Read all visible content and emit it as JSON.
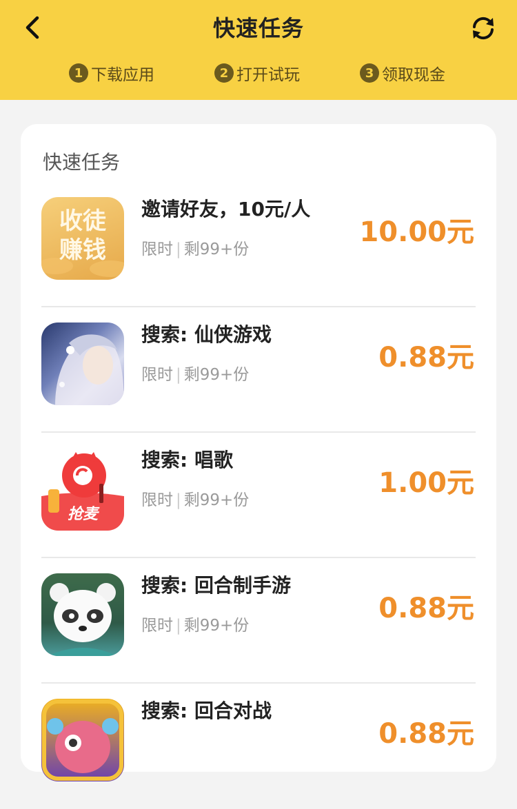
{
  "header": {
    "title": "快速任务",
    "steps": [
      {
        "num": "1",
        "label": "下载应用"
      },
      {
        "num": "2",
        "label": "打开试玩"
      },
      {
        "num": "3",
        "label": "领取现金"
      }
    ]
  },
  "section": {
    "title": "快速任务"
  },
  "tasks": [
    {
      "icon": "invite-friends-app-icon",
      "icon_text_1": "收徒",
      "icon_text_2": "赚钱",
      "name": "邀请好友，10元/人",
      "tag": "限时",
      "remaining": "剩99+份",
      "reward": "10.00元"
    },
    {
      "icon": "xianxia-game-app-icon",
      "name": "搜索: 仙侠游戏",
      "tag": "限时",
      "remaining": "剩99+份",
      "reward": "0.88元"
    },
    {
      "icon": "qiangmai-karaoke-app-icon",
      "icon_label": "抢麦",
      "name": "搜索: 唱歌",
      "tag": "限时",
      "remaining": "剩99+份",
      "reward": "1.00元"
    },
    {
      "icon": "panda-game-app-icon",
      "name": "搜索: 回合制手游",
      "tag": "限时",
      "remaining": "剩99+份",
      "reward": "0.88元"
    },
    {
      "icon": "battle-game-app-icon",
      "name": "搜索: 回合对战",
      "tag": "",
      "remaining": "",
      "reward": "0.88元"
    }
  ],
  "colors": {
    "header_bg": "#f8d143",
    "reward": "#ef8f2b"
  }
}
